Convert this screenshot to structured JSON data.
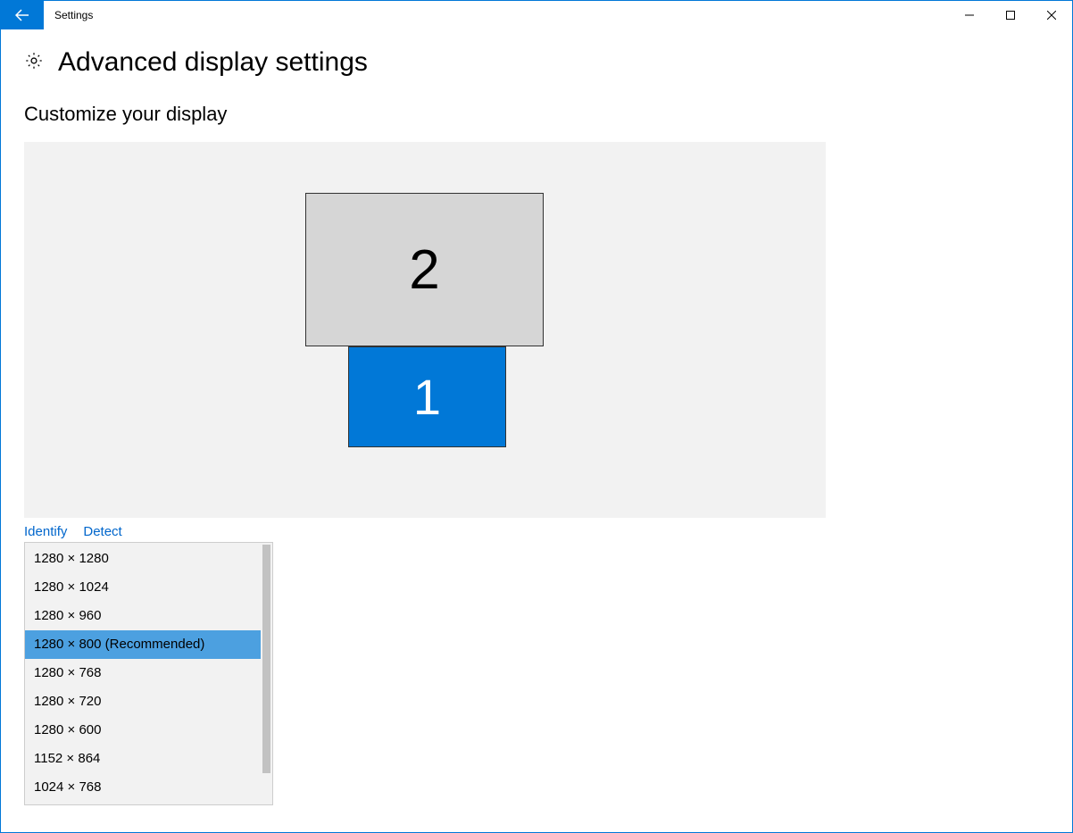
{
  "window": {
    "title": "Settings"
  },
  "page": {
    "heading": "Advanced display settings",
    "section": "Customize your display"
  },
  "monitors": {
    "primary_label": "1",
    "secondary_label": "2"
  },
  "links": {
    "identify": "Identify",
    "detect": "Detect"
  },
  "resolution": {
    "selected_index": 3,
    "options": [
      "1280 × 1280",
      "1280 × 1024",
      "1280 × 960",
      "1280 × 800 (Recommended)",
      "1280 × 768",
      "1280 × 720",
      "1280 × 600",
      "1152 × 864",
      "1024 × 768"
    ]
  }
}
